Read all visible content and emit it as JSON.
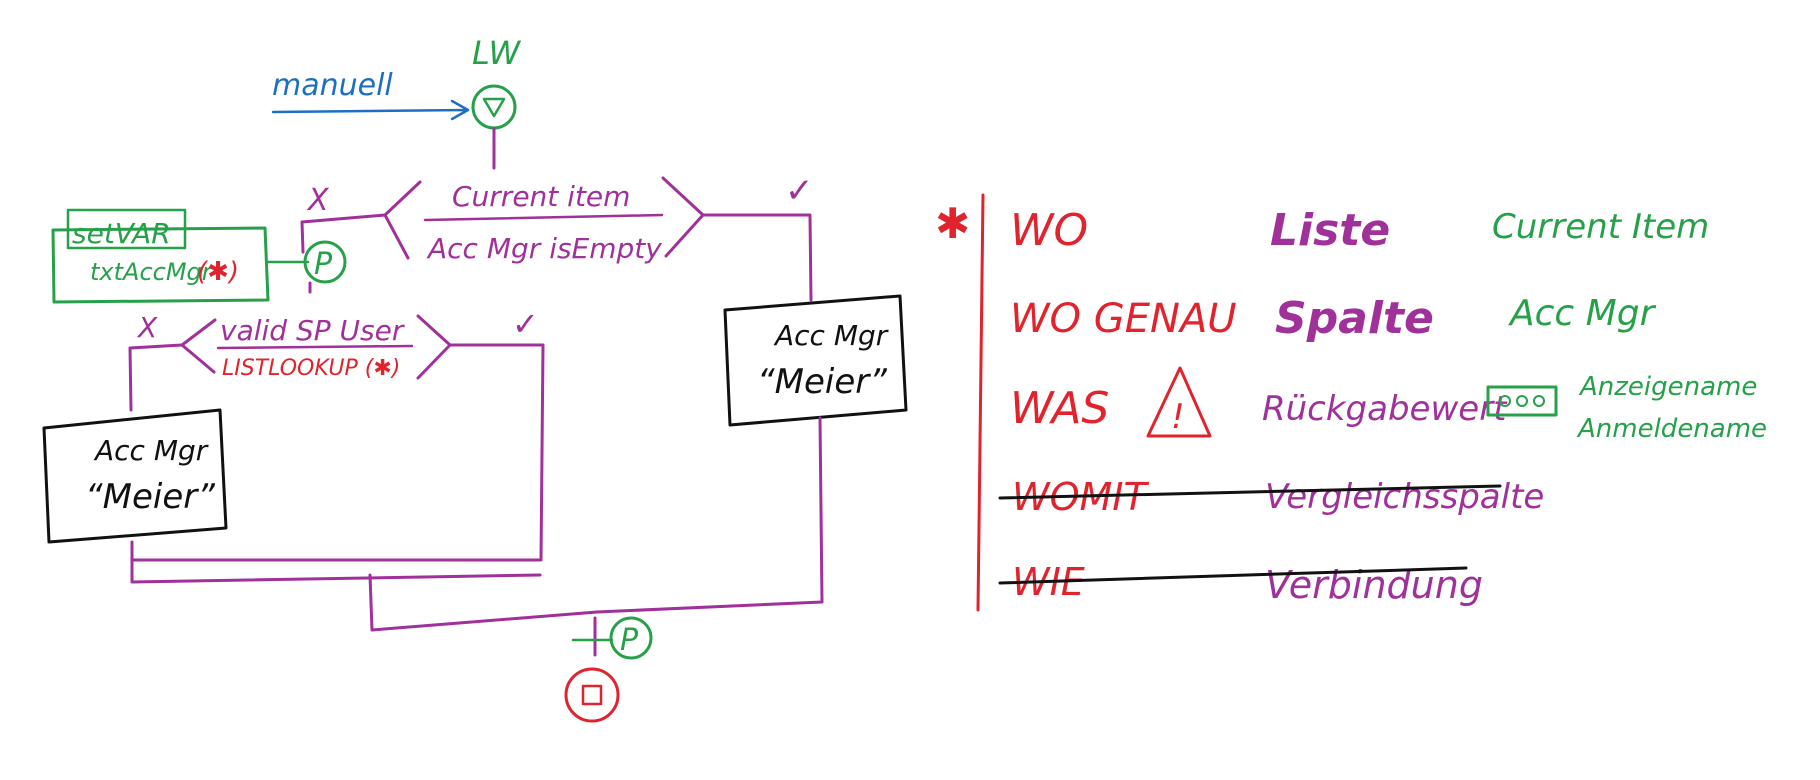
{
  "flow": {
    "trigger_label": "manuell",
    "start_label": "LW",
    "condition1": {
      "top": "Current item",
      "bottom": "Acc Mgr isEmpty",
      "no_mark": "X",
      "yes_mark": "✓"
    },
    "setvar": {
      "title": "setVAR",
      "body": "txtAccMgr",
      "marker": "(✱)",
      "p_label": "P"
    },
    "condition2": {
      "top": "valid SP User",
      "bottom": "LISTLOOKUP (✱)",
      "no_mark": "X",
      "yes_mark": "✓"
    },
    "box_left": {
      "line1": "Acc Mgr",
      "line2": "“Meier”"
    },
    "box_right": {
      "line1": "Acc Mgr",
      "line2": "“Meier”"
    },
    "end_p_label": "P"
  },
  "legend": {
    "marker": "✱",
    "col1": [
      "WO",
      "WO GENAU",
      "WAS",
      "WOMIT",
      "WIE"
    ],
    "col2": [
      "Liste",
      "Spalte",
      "Rückgabewert",
      "Vergleichsspalte",
      "Verbindung"
    ],
    "col3": [
      "Current Item",
      "Acc Mgr"
    ],
    "display_name": "Anzeigename",
    "login_name": "Anmeldename",
    "warning_symbol": "!",
    "strikethrough_rows": [
      3,
      4
    ]
  },
  "colors": {
    "purple": "#a0309a",
    "green": "#27a04a",
    "red": "#e0232d",
    "blue": "#1e6fc4",
    "black": "#111111"
  },
  "icons": {
    "start": "triangle-circle-icon",
    "end": "square-circle-icon",
    "warning": "warning-triangle-icon",
    "field": "field-box-icon"
  }
}
